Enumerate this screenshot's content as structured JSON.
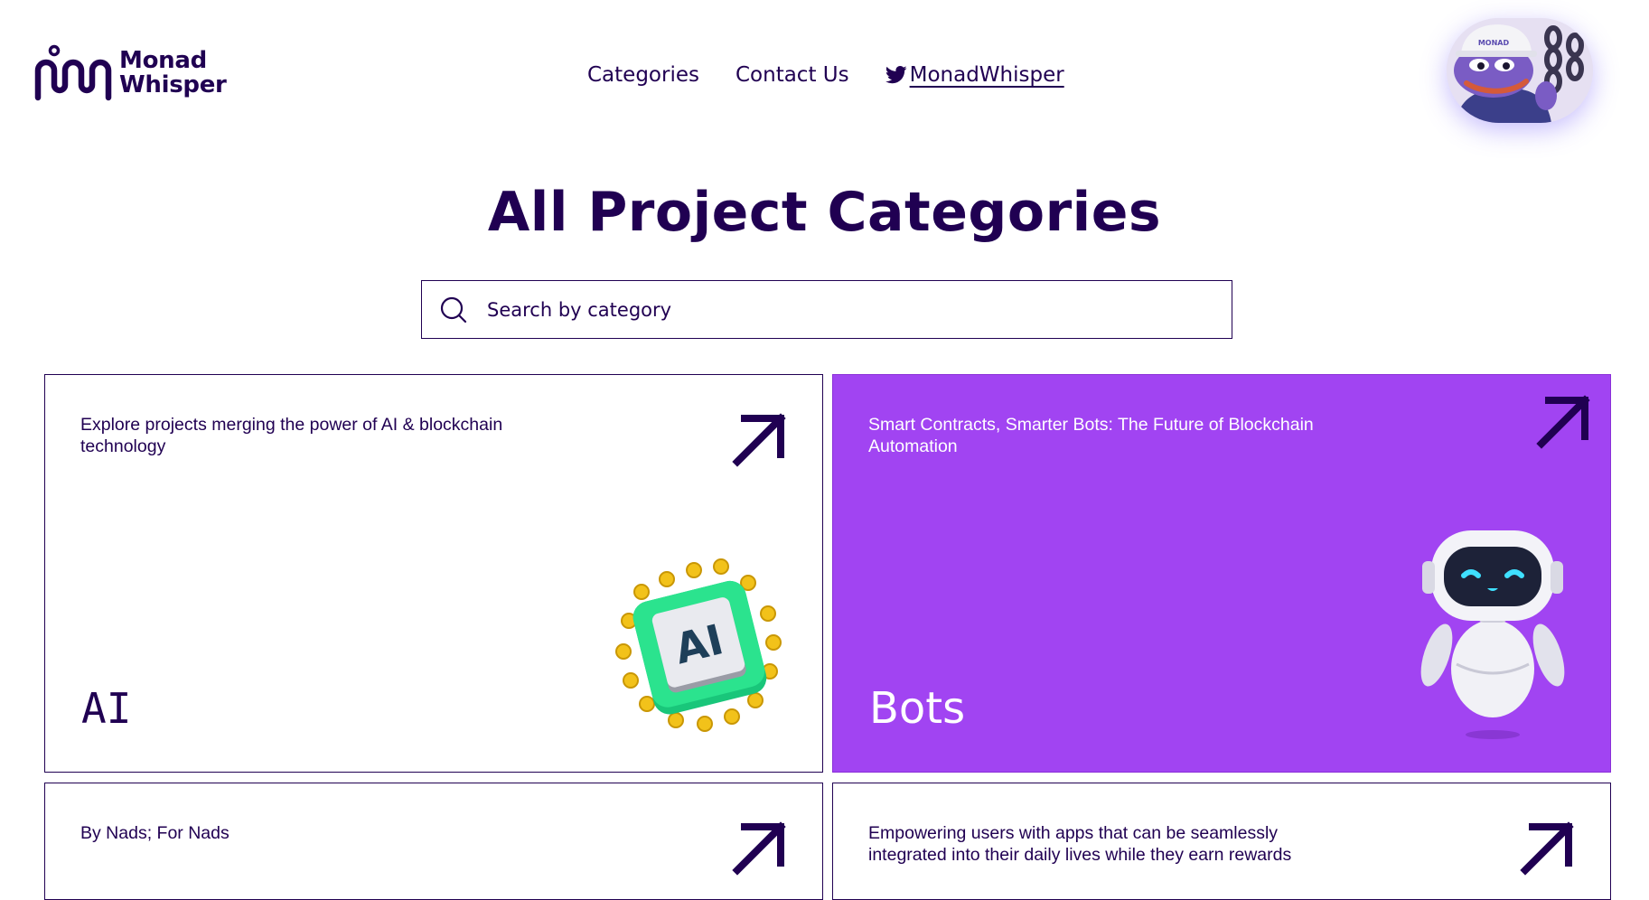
{
  "brand": {
    "name_line1": "Monad",
    "name_line2": "Whisper"
  },
  "nav": {
    "items": [
      {
        "label": "Categories"
      },
      {
        "label": "Contact Us"
      },
      {
        "label": "MonadWhisper",
        "icon": "twitter-icon"
      }
    ]
  },
  "avatar": {
    "icon": "pepe-avatar",
    "hat_text": "MONAD"
  },
  "page": {
    "title": "All Project Categories"
  },
  "search": {
    "placeholder": "Search by category",
    "value": "",
    "icon": "search-icon"
  },
  "cards": [
    {
      "title": "AI",
      "description": "Explore projects merging the power of AI & blockchain technology",
      "icon": "ai-chip-icon",
      "chip_label": "AI",
      "theme": "white"
    },
    {
      "title": "Bots",
      "description": "Smart Contracts, Smarter Bots: The Future of Blockchain Automation",
      "icon": "robot-icon",
      "theme": "purple"
    },
    {
      "title": "",
      "description": "By Nads; For Nads",
      "theme": "white"
    },
    {
      "title": "",
      "description": "Empowering users with apps that can be seamlessly integrated into their daily lives while they earn rewards",
      "theme": "white"
    }
  ],
  "colors": {
    "primary": "#200052",
    "accent_purple": "#a144f2",
    "background": "#ffffff"
  }
}
